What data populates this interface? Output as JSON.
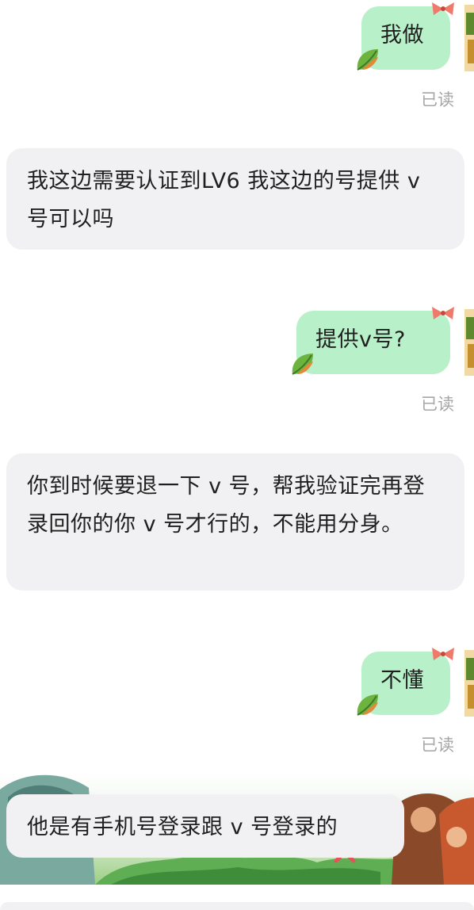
{
  "messages": [
    {
      "side": "me",
      "text": "我做",
      "status": "已读"
    },
    {
      "side": "them",
      "text": "我这边需要认证到LV6 我这边的号提供 v 号可以吗"
    },
    {
      "side": "me",
      "text": "提供v号?",
      "status": "已读"
    },
    {
      "side": "them",
      "text": "你到时候要退一下 v 号，帮我验证完再登录回你的你 v 号才行的，不能用分身。"
    },
    {
      "side": "me",
      "text": "不懂",
      "status": "已读"
    },
    {
      "side": "them",
      "text": "他是有手机号登录跟 v 号登录的"
    }
  ],
  "colors": {
    "mine": "#b8f0c9",
    "theirs": "#f1f1f3",
    "read": "#a6a6a6"
  },
  "icons": [
    "leaf-icon",
    "bow-icon",
    "watermark-logo"
  ]
}
